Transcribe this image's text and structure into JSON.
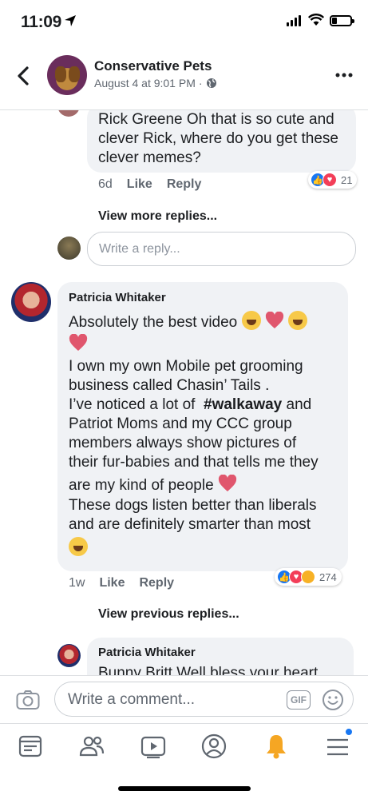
{
  "status_bar": {
    "time": "11:09"
  },
  "header": {
    "page_name": "Conservative Pets",
    "post_date": "August 4 at 9:01 PM",
    "separator": "·"
  },
  "thread": {
    "reply1": {
      "name": "Rick Greene",
      "text": "Oh that is so cute and clever Rick, where do you get these clever memes?",
      "age": "6d",
      "like_label": "Like",
      "reply_label": "Reply",
      "reaction_count": "21"
    },
    "view_more_replies": "View more replies...",
    "reply_placeholder": "Write a reply..."
  },
  "comment": {
    "name": "Patricia Whitaker",
    "line1": "Absolutely the best video",
    "para2_l1": "I own my own Mobile pet grooming",
    "para2_l2": "business called Chasin’ Tails .",
    "para2_l3a": "I’ve noticed a lot of",
    "hashtag": "#walkaway",
    "para2_l3b": "and",
    "para2_l4": "Patriot Moms and my CCC group",
    "para2_l5": "members always show pictures of",
    "para2_l6": "their fur-babies and that tells me they",
    "para2_l7": "are my kind of people",
    "para3_l1": "These dogs listen better than liberals",
    "para3_l2": "and are definitely smarter than most",
    "age": "1w",
    "like_label": "Like",
    "reply_label": "Reply",
    "reaction_count": "274"
  },
  "view_previous_replies": "View previous replies...",
  "nested_reply": {
    "name": "Patricia Whitaker",
    "text": "Bunny Britt  Well bless your heart."
  },
  "composer": {
    "placeholder": "Write a comment...",
    "gif_label": "GIF"
  },
  "tabbar": {
    "items": [
      "news-feed",
      "friends",
      "watch",
      "profile",
      "notifications",
      "menu"
    ],
    "active": "notifications",
    "accent": "#1877f2",
    "bell_color": "#f5a623"
  }
}
